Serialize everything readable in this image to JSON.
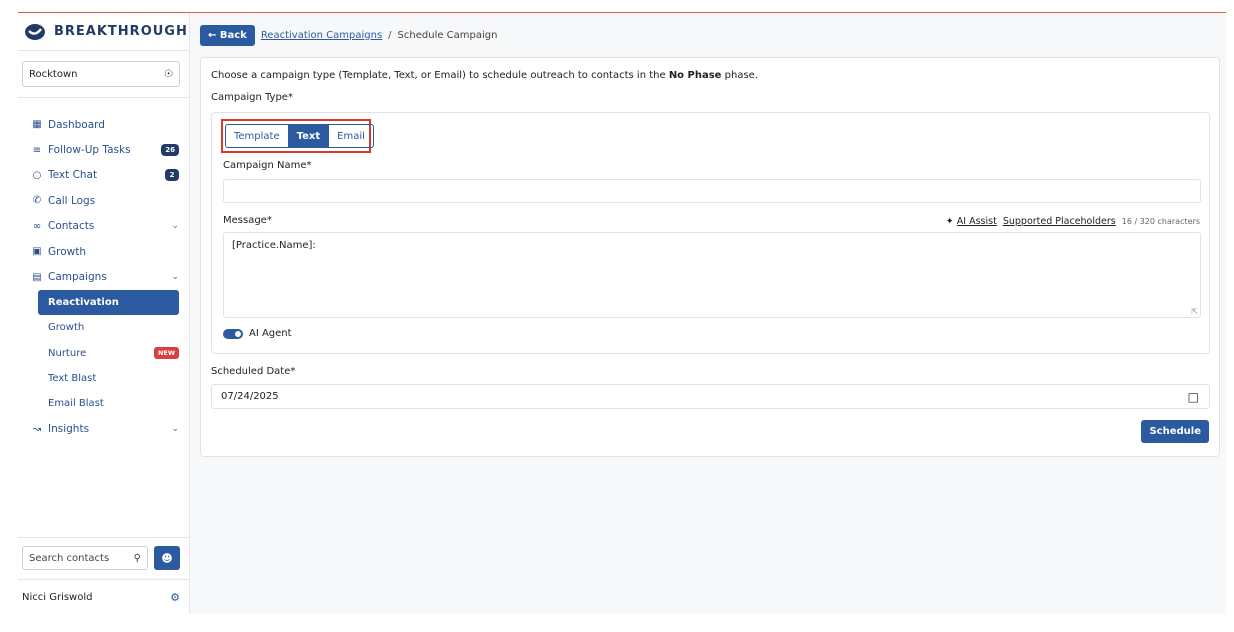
{
  "brand": {
    "name": "BREAKTHROUGH"
  },
  "location": {
    "value": "Rocktown"
  },
  "nav": {
    "dashboard": "Dashboard",
    "follow_up": {
      "label": "Follow-Up Tasks",
      "badge": "26"
    },
    "text_chat": {
      "label": "Text Chat",
      "badge": "2"
    },
    "call_logs": "Call Logs",
    "contacts": "Contacts",
    "growth": "Growth",
    "campaigns": "Campaigns",
    "sub": {
      "reactivation": "Reactivation",
      "growth": "Growth",
      "nurture": "Nurture",
      "nurture_badge": "NEW",
      "text_blast": "Text Blast",
      "email_blast": "Email Blast"
    },
    "insights": "Insights"
  },
  "search": {
    "placeholder": "Search contacts"
  },
  "user": {
    "name": "Nicci Griswold"
  },
  "breadcrumb": {
    "back": "← Back",
    "parent": "Reactivation Campaigns",
    "sep": "/",
    "current": "Schedule Campaign"
  },
  "form": {
    "intro_pre": "Choose a campaign type (Template, Text, or Email) to schedule outreach to contacts in the ",
    "intro_bold": "No Phase",
    "intro_post": " phase.",
    "type_label": "Campaign Type*",
    "types": [
      "Template",
      "Text",
      "Email"
    ],
    "selected_type": "Text",
    "name_label": "Campaign Name*",
    "name_value": "",
    "message_label": "Message*",
    "ai_assist": "AI Assist",
    "placeholders": "Supported Placeholders",
    "char_count": "16 / 320 characters",
    "message_value": "[Practice.Name]:",
    "agent_label": "AI Agent",
    "agent_on": true,
    "date_label": "Scheduled Date*",
    "date_value": "07/24/2025",
    "schedule_button": "Schedule"
  },
  "colors": {
    "primary": "#2c5aa0",
    "highlight": "#d9382e",
    "new_badge": "#d84040"
  }
}
